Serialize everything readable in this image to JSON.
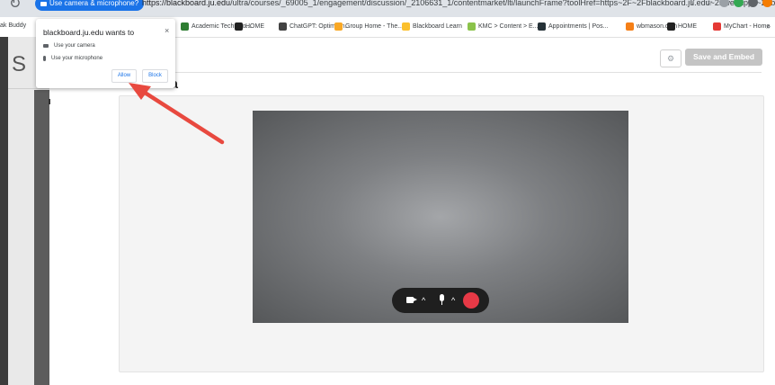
{
  "browser": {
    "permission_chip": "Use camera & microphone?",
    "url_host": "https://blackboard.ju.edu",
    "url_rest": "/ultra/courses/_69005_1/engagement/discussion/_2106631_1/contentmarket/lti/launchFrame?toolHref=https~2F~2Fblackboard.ju.edu~2Fwebapps~2Fblackboard~2Fexecute~2F..."
  },
  "bookmarks": {
    "left_partial": "ak Buddy",
    "items": [
      {
        "label": "Academic Technolo...",
        "color": "#2e7d32"
      },
      {
        "label": "HOME",
        "color": "#212121"
      },
      {
        "label": "ChatGPT: Optimizin...",
        "color": "#424242"
      },
      {
        "label": "Group Home - The...",
        "color": "#f9a825"
      },
      {
        "label": "Blackboard Learn",
        "color": "#fbc02d"
      },
      {
        "label": "KMC > Content > E...",
        "color": "#8bc34a"
      },
      {
        "label": "Appointments | Pos...",
        "color": "#263238"
      },
      {
        "label": "wbmason.com",
        "color": "#f57f17"
      },
      {
        "label": "HOME",
        "color": "#212121"
      },
      {
        "label": "MyChart - Home",
        "color": "#e53935"
      }
    ],
    "more": "»"
  },
  "popup": {
    "title": "blackboard.ju.edu wants to",
    "close": "×",
    "camera": "Use your camera",
    "microphone": "Use your microphone",
    "allow": "Allow",
    "block": "Block"
  },
  "page": {
    "sidebar_letter": "S",
    "title_partial": "edia",
    "save_label": "Save and Embed",
    "settings_icon": "⚙"
  },
  "controls": {
    "chevron": "^"
  },
  "colors": {
    "accent": "#1a73e8",
    "record": "#e63946",
    "arrow": "#e8493f"
  }
}
